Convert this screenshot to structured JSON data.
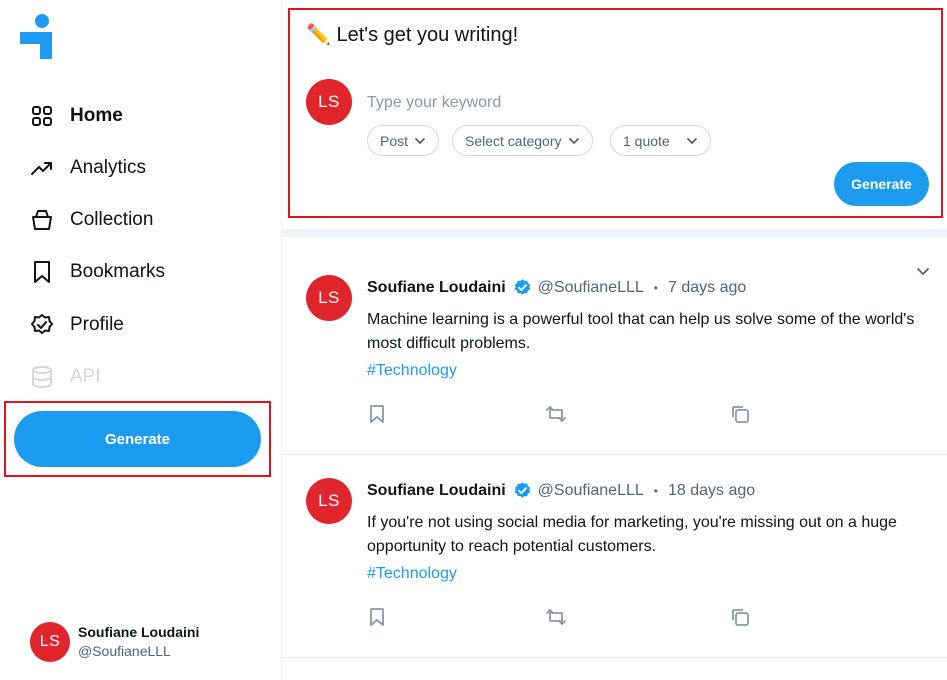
{
  "sidebar": {
    "logo_icon": "brand-logo-icon",
    "items": [
      {
        "label": "Home",
        "icon": "grid-icon"
      },
      {
        "label": "Analytics",
        "icon": "trend-icon"
      },
      {
        "label": "Collection",
        "icon": "basket-icon"
      },
      {
        "label": "Bookmarks",
        "icon": "bookmark-icon"
      },
      {
        "label": "Profile",
        "icon": "badge-icon"
      },
      {
        "label": "API",
        "icon": "database-icon"
      }
    ],
    "generate_label": "Generate",
    "user": {
      "initials": "LS",
      "name": "Soufiane Loudaini",
      "handle": "@SoufianeLLL"
    }
  },
  "composer": {
    "emoji": "✏️",
    "title": "Let's get you writing!",
    "avatar_initials": "LS",
    "keyword_placeholder": "Type your keyword",
    "type_select": "Post",
    "category_select": "Select category",
    "quote_select": "1 quote",
    "generate_label": "Generate"
  },
  "feed": [
    {
      "avatar_initials": "LS",
      "author": "Soufiane Loudaini",
      "handle": "@SoufianeLLL",
      "separator": "•",
      "time": "7 days ago",
      "text": "Machine learning is a powerful tool that can help us solve some of the world's most difficult problems.",
      "tag": "#Technology"
    },
    {
      "avatar_initials": "LS",
      "author": "Soufiane Loudaini",
      "handle": "@SoufianeLLL",
      "separator": "•",
      "time": "18 days ago",
      "text": "If you're not using social media for marketing, you're missing out on a huge opportunity to reach potential customers.",
      "tag": "#Technology"
    }
  ],
  "colors": {
    "accent": "#1d9bf0",
    "avatar": "#e0252d",
    "highlight_frame": "#e0141b"
  }
}
